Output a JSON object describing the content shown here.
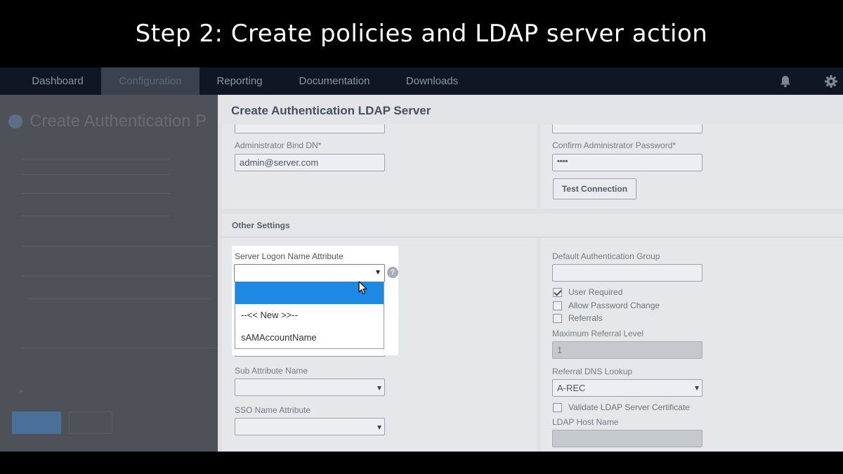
{
  "banner": {
    "title": "Step 2: Create policies and LDAP server action"
  },
  "nav": {
    "tabs": [
      {
        "label": "Dashboard"
      },
      {
        "label": "Configuration"
      },
      {
        "label": "Reporting"
      },
      {
        "label": "Documentation"
      },
      {
        "label": "Downloads"
      }
    ],
    "active_tab": "Configuration",
    "icons": [
      "bell-icon",
      "gear-icon"
    ]
  },
  "background_page": {
    "title": "Create Authentication P"
  },
  "modal": {
    "title": "Create Authentication LDAP Server",
    "admin_bind_dn": {
      "label": "Administrator Bind DN*",
      "value": "admin@server.com"
    },
    "confirm_password": {
      "label": "Confirm Administrator Password*",
      "value": "••••"
    },
    "test_connection_label": "Test Connection",
    "other_settings": {
      "title": "Other Settings",
      "server_logon_name_attribute": {
        "label": "Server Logon Name Attribute",
        "value": "",
        "options": [
          "",
          "--<< New >>--",
          "sAMAccountName"
        ],
        "selected_index": 0
      },
      "sub_attribute_name": {
        "label": "Sub Attribute Name",
        "value": ""
      },
      "sso_name_attribute": {
        "label": "SSO Name Attribute",
        "value": ""
      },
      "default_authentication_group": {
        "label": "Default Authentication Group",
        "value": ""
      },
      "checkboxes": [
        {
          "label": "User Required",
          "checked": true
        },
        {
          "label": "Allow Password Change",
          "checked": false
        },
        {
          "label": "Referrals",
          "checked": false
        }
      ],
      "maximum_referral_level": {
        "label": "Maximum Referral Level",
        "value": "1"
      },
      "referral_dns_lookup": {
        "label": "Referral DNS Lookup",
        "value": "A-REC"
      },
      "validate_ldap_server_certificate": {
        "label": "Validate LDAP Server Certificate",
        "checked": false
      },
      "ldap_host_name": {
        "label": "LDAP Host Name",
        "value": ""
      }
    }
  },
  "colors": {
    "accent": "#1e88e5",
    "nav_bg": "#0f1724"
  }
}
